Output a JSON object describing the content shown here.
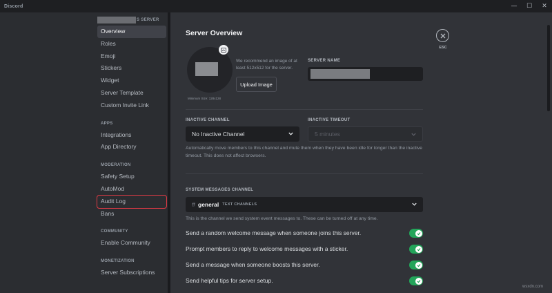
{
  "window": {
    "title": "Discord",
    "controls": [
      "—",
      "☐",
      "✕"
    ]
  },
  "sidebar": {
    "server_name_suffix": "S SERVER",
    "items_top": [
      {
        "label": "Overview",
        "active": true
      },
      {
        "label": "Roles"
      },
      {
        "label": "Emoji"
      },
      {
        "label": "Stickers"
      },
      {
        "label": "Widget"
      },
      {
        "label": "Server Template"
      },
      {
        "label": "Custom Invite Link"
      }
    ],
    "apps_section": "APPS",
    "apps_items": [
      {
        "label": "Integrations"
      },
      {
        "label": "App Directory"
      }
    ],
    "moderation_section": "MODERATION",
    "moderation_items": [
      {
        "label": "Safety Setup"
      },
      {
        "label": "AutoMod"
      },
      {
        "label": "Audit Log",
        "highlighted": true
      },
      {
        "label": "Bans"
      }
    ],
    "community_section": "COMMUNITY",
    "community_items": [
      {
        "label": "Enable Community"
      }
    ],
    "monetization_section": "MONETIZATION",
    "monetization_items": [
      {
        "label": "Server Subscriptions"
      }
    ]
  },
  "main": {
    "title": "Server Overview",
    "icon": {
      "recommendation": "We recommend an image of at least 512x512 for the server.",
      "upload_button": "Upload Image",
      "minimum_size": "Minimum Size: 128x128"
    },
    "server_name_label": "SERVER NAME",
    "inactive_channel": {
      "label": "INACTIVE CHANNEL",
      "value": "No Inactive Channel"
    },
    "inactive_timeout": {
      "label": "INACTIVE TIMEOUT",
      "value": "5 minutes"
    },
    "inactive_description": "Automatically move members to this channel and mute them when they have been idle for longer than the inactive timeout. This does not affect browsers.",
    "system_messages": {
      "label": "SYSTEM MESSAGES CHANNEL",
      "channel_hash": "#",
      "channel_name": "general",
      "channel_category": "TEXT CHANNELS",
      "description": "This is the channel we send system event messages to. These can be turned off at any time."
    },
    "toggles": [
      {
        "label": "Send a random welcome message when someone joins this server.",
        "on": true
      },
      {
        "label": "Prompt members to reply to welcome messages with a sticker.",
        "on": true
      },
      {
        "label": "Send a message when someone boosts this server.",
        "on": true
      },
      {
        "label": "Send helpful tips for server setup.",
        "on": true
      }
    ],
    "close_label": "ESC"
  },
  "watermark": "wsxdn.com",
  "colors": {
    "background": "#313338",
    "sidebar": "#2b2d31",
    "input": "#1e1f22",
    "toggle_on": "#23a55a",
    "highlight_outline": "#e03a45"
  }
}
